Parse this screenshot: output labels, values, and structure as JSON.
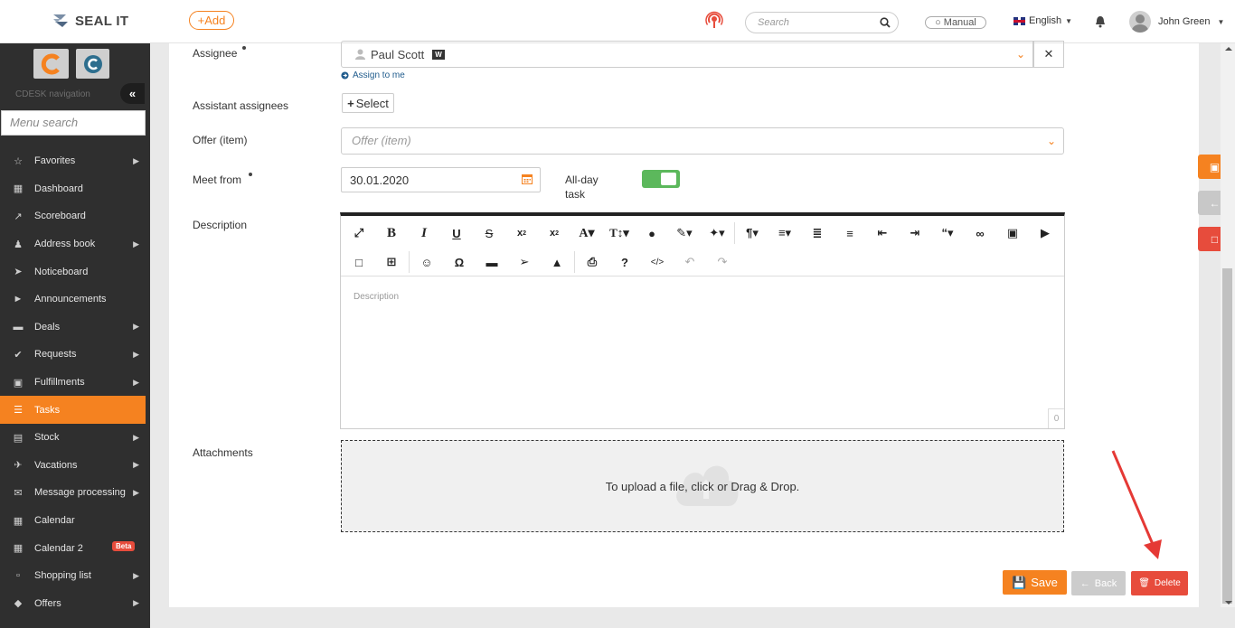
{
  "app": {
    "logo_text": "SEAL IT",
    "add_label": "+Add"
  },
  "header": {
    "search_placeholder": "Search",
    "manual_label": "Manual",
    "language": "English",
    "user_name": "John Green"
  },
  "sidebar": {
    "nav_label": "CDESK navigation",
    "menu_search_placeholder": "Menu search",
    "items": [
      {
        "label": "Favorites",
        "icon": "star-icon",
        "submenu": true
      },
      {
        "label": "Dashboard",
        "icon": "bar-chart-icon",
        "submenu": false
      },
      {
        "label": "Scoreboard",
        "icon": "line-chart-icon",
        "submenu": false
      },
      {
        "label": "Address book",
        "icon": "user-icon",
        "submenu": true
      },
      {
        "label": "Noticeboard",
        "icon": "paper-plane-icon",
        "submenu": false
      },
      {
        "label": "Announcements",
        "icon": "megaphone-icon",
        "submenu": false
      },
      {
        "label": "Deals",
        "icon": "money-icon",
        "submenu": true
      },
      {
        "label": "Requests",
        "icon": "check-circle-icon",
        "submenu": true
      },
      {
        "label": "Fulfillments",
        "icon": "cube-icon",
        "submenu": true
      },
      {
        "label": "Tasks",
        "icon": "tasks-icon",
        "submenu": false,
        "active": true
      },
      {
        "label": "Stock",
        "icon": "archive-icon",
        "submenu": true
      },
      {
        "label": "Vacations",
        "icon": "plane-icon",
        "submenu": true
      },
      {
        "label": "Message processing",
        "icon": "envelope-icon",
        "submenu": true
      },
      {
        "label": "Calendar",
        "icon": "calendar-icon",
        "submenu": false
      },
      {
        "label": "Calendar 2",
        "icon": "calendar-icon",
        "submenu": false,
        "badge": "Beta"
      },
      {
        "label": "Shopping list",
        "icon": "cart-icon",
        "submenu": true
      },
      {
        "label": "Offers",
        "icon": "tag-icon",
        "submenu": true
      }
    ]
  },
  "form": {
    "assignee_label": "Assignee",
    "assignee_value": "Paul Scott",
    "assignee_badge": "W",
    "assign_to_me": "Assign to me",
    "assistant_label": "Assistant assignees",
    "select_label": "Select",
    "offer_label": "Offer (item)",
    "offer_placeholder": "Offer (item)",
    "meet_from_label": "Meet from",
    "meet_from_value": "30.01.2020",
    "all_day_label_1": "All-day",
    "all_day_label_2": "task",
    "all_day_on": true,
    "description_label": "Description",
    "description_placeholder": "Description",
    "char_count": "0",
    "attachments_label": "Attachments",
    "upload_text": "To upload a file, click or Drag & Drop."
  },
  "actions": {
    "save": "Save",
    "back": "Back",
    "delete": "Delete"
  },
  "colors": {
    "accent": "#f58220",
    "danger": "#e74c3c",
    "success": "#5cb85c",
    "sidebar": "#2f2f2f"
  }
}
